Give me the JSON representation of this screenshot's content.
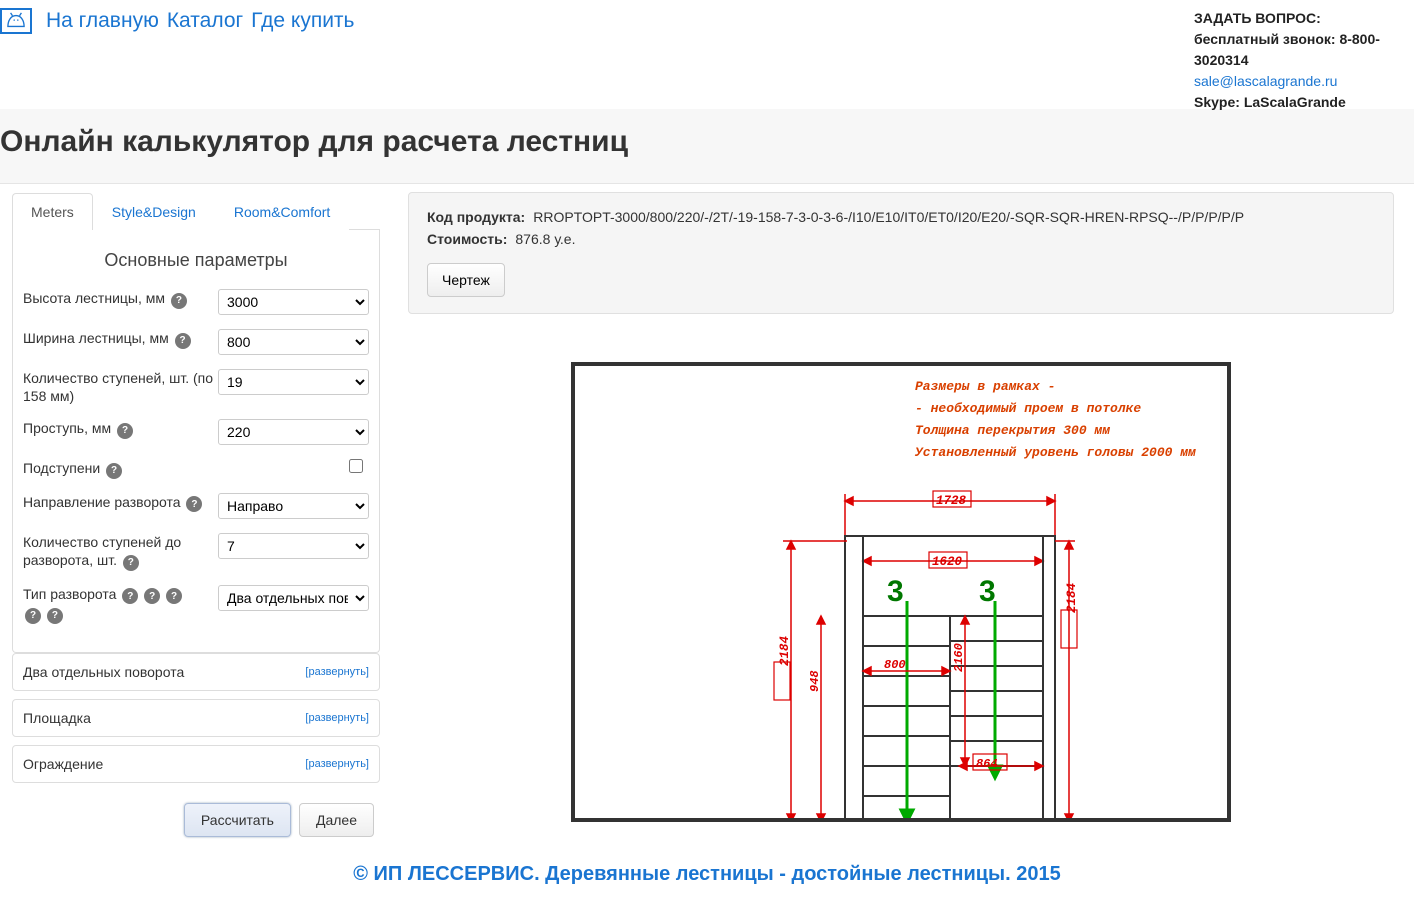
{
  "nav": {
    "home": "На главную",
    "catalog": "Каталог",
    "where": "Где купить"
  },
  "contact": {
    "ask": "ЗАДАТЬ ВОПРОС:",
    "free_call_label": "бесплатный звонок:",
    "free_call_value": "8-800-3020314",
    "email": "sale@lascalagrande.ru",
    "skype_label": "Skype:",
    "skype_value": "LaScalaGrande"
  },
  "page_title": "Онлайн калькулятор для расчета лестниц",
  "tabs": {
    "meters": "Meters",
    "style": "Style&Design",
    "room": "Room&Comfort"
  },
  "panel": {
    "heading": "Основные параметры",
    "rows": {
      "height": {
        "label": "Высота лестницы, мм",
        "value": "3000"
      },
      "width": {
        "label": "Ширина лестницы, мм",
        "value": "800"
      },
      "steps": {
        "label": "Количество ступеней, шт. (по 158 мм)",
        "value": "19"
      },
      "tread": {
        "label": "Проступь, мм",
        "value": "220"
      },
      "risers": {
        "label": "Подступени"
      },
      "turn_dir": {
        "label": "Направление разворота",
        "value": "Направо"
      },
      "steps_before_turn": {
        "label": "Количество ступеней до разворота, шт.",
        "value": "7"
      },
      "turn_type": {
        "label": "Тип разворота",
        "value": "Два отдельных пово"
      }
    },
    "accordion": {
      "two_turns": "Два отдельных поворота",
      "platform": "Площадка",
      "railing": "Ограждение",
      "expand": "[развернуть]"
    },
    "buttons": {
      "calc": "Рассчитать",
      "next": "Далее"
    }
  },
  "product": {
    "code_label": "Код продукта:",
    "code_value": "RROPTOPT-3000/800/220/-/2T/-19-158-7-3-0-3-6-/I10/E10/IT0/ET0/I20/E20/-SQR-SQR-HREN-RPSQ--/P/P/P/P/P",
    "cost_label": "Стоимость:",
    "cost_value": "876.8 у.е.",
    "drawing_btn": "Чертеж"
  },
  "drawing_legend": {
    "l1": "Размеры в рамках -",
    "l2": "- необходимый проем в потолке",
    "l3": "Толщина перекрытия 300 мм",
    "l4": "Установленный уровень головы 2000 мм"
  },
  "dims": {
    "top_outer": "1728",
    "top_inner": "1620",
    "left_outer": "2184",
    "left_inner": "948",
    "right_outer": "2184",
    "right_inner": "2160",
    "mid_800": "800",
    "low_864": "864"
  },
  "arrows": {
    "three": "3"
  },
  "footer": "© ИП ЛЕССЕРВИС. Деревянные лестницы - достойные лестницы. 2015"
}
